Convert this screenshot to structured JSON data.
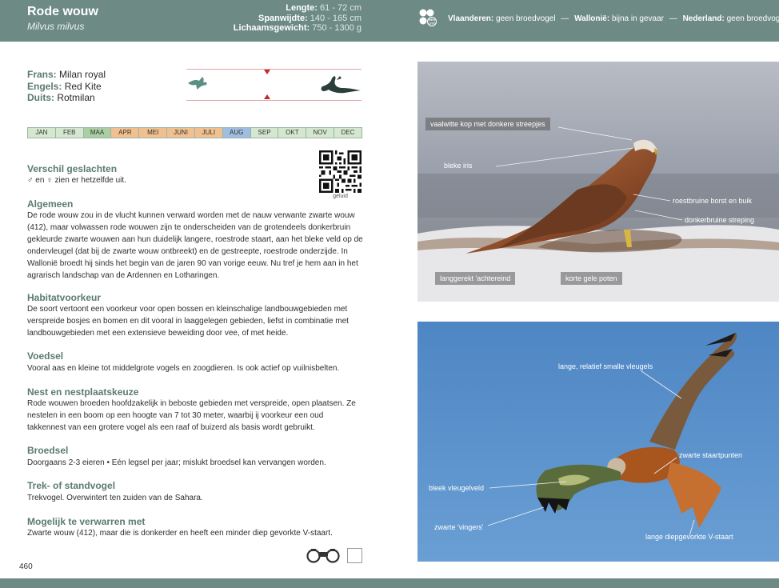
{
  "header": {
    "title": "Rode wouw",
    "latin": "Milvus milvus",
    "measurements": [
      {
        "label": "Lengte:",
        "value": "61 - 72 cm"
      },
      {
        "label": "Spanwijdte:",
        "value": "140 - 165 cm"
      },
      {
        "label": "Lichaamsgewicht:",
        "value": "750 - 1300 g"
      }
    ],
    "redlist_logo_text": "RED LIST",
    "status": [
      {
        "region": "Vlaanderen:",
        "value": "geen broedvogel"
      },
      {
        "region": "Wallonië:",
        "value": "bijna in gevaar"
      },
      {
        "region": "Nederland:",
        "value": "geen broedvogel"
      }
    ],
    "separator": "—"
  },
  "names": [
    {
      "label": "Frans:",
      "value": "Milan royal"
    },
    {
      "label": "Engels:",
      "value": "Red Kite"
    },
    {
      "label": "Duits:",
      "value": "Rotmilan"
    }
  ],
  "months": [
    {
      "label": "JAN",
      "color": "#d5e8cf"
    },
    {
      "label": "FEB",
      "color": "#d5e8cf"
    },
    {
      "label": "MAA",
      "color": "#a9cfa2"
    },
    {
      "label": "APR",
      "color": "#f1c08f"
    },
    {
      "label": "MEI",
      "color": "#f1c08f"
    },
    {
      "label": "JUNI",
      "color": "#f1c08f"
    },
    {
      "label": "JULI",
      "color": "#f1c08f"
    },
    {
      "label": "AUG",
      "color": "#9fbde0"
    },
    {
      "label": "SEP",
      "color": "#d5e8cf"
    },
    {
      "label": "OKT",
      "color": "#d5e8cf"
    },
    {
      "label": "NOV",
      "color": "#d5e8cf"
    },
    {
      "label": "DEC",
      "color": "#d5e8cf"
    }
  ],
  "qr_caption": "geluid",
  "sections": {
    "verschil": {
      "title": "Verschil geslachten",
      "text": "♂ en ♀ zien er hetzelfde uit."
    },
    "algemeen": {
      "title": "Algemeen",
      "text": "De rode wouw zou in de vlucht kunnen verward worden met de nauw verwante zwarte wouw (412), maar volwassen rode wouwen zijn te onderscheiden van de grotendeels donkerbruin gekleurde zwarte wouwen aan hun duidelijk langere, roestrode staart, aan het bleke veld op de ondervleugel (dat bij de zwarte wouw ontbreekt) en de gestreepte, roestrode onderzijde. In Wallonië broedt hij sinds het begin van de jaren 90 van vorige eeuw. Nu tref je hem aan in het agrarisch landschap van de Ardennen en Lotharingen."
    },
    "habitat": {
      "title": "Habitatvoorkeur",
      "text": "De soort vertoont een voorkeur voor open bossen en kleinschalige landbouwgebieden met verspreide bosjes en bomen en dit vooral in laaggelegen gebieden, liefst in combinatie met landbouwgebieden met een extensieve beweiding door vee, of met heide."
    },
    "voedsel": {
      "title": "Voedsel",
      "text": "Vooral aas en kleine tot middelgrote vogels en zoogdieren. Is ook actief op vuilnisbelten."
    },
    "nest": {
      "title": "Nest en nestplaatskeuze",
      "text": "Rode wouwen broeden hoofdzakelijk in beboste gebieden met verspreide, open plaatsen. Ze nestelen in een boom op een hoogte van 7 tot 30 meter, waarbij ij voorkeur een oud takkennest van een grotere vogel als een raaf of buizerd als basis wordt gebruikt."
    },
    "broedsel": {
      "title": "Broedsel",
      "text": "Doorgaans 2-3 eieren  •  Eén legsel per jaar; mislukt broedsel kan vervangen worden."
    },
    "trek": {
      "title": "Trek- of standvogel",
      "text": "Trekvogel. Overwintert ten zuiden van de Sahara."
    },
    "verwarren": {
      "title": "Mogelijk te verwarren met",
      "text": "Zwarte wouw (412), maar die is donkerder en heeft een minder diep gevorkte V-staart."
    }
  },
  "photo1_labels": {
    "kop": "vaalwitte kop met donkere streepjes",
    "iris": "bleke iris",
    "borst": "roestbruine borst en buik",
    "streping": "donkerbruine streping",
    "achtereind": "langgerekt 'achtereind",
    "poten": "korte gele poten"
  },
  "photo2_labels": {
    "vleugels": "lange, relatief smalle vleugels",
    "staartpunten": "zwarte staartpunten",
    "vleugelveld": "bleek vleugelveld",
    "vingers": "zwarte 'vingers'",
    "vstaart": "lange diepgevorkte V-staart"
  },
  "page_number": "460",
  "colors": {
    "header": "#6d8a84",
    "section_title": "#5b7a72",
    "sky": "#5b8fc8"
  }
}
